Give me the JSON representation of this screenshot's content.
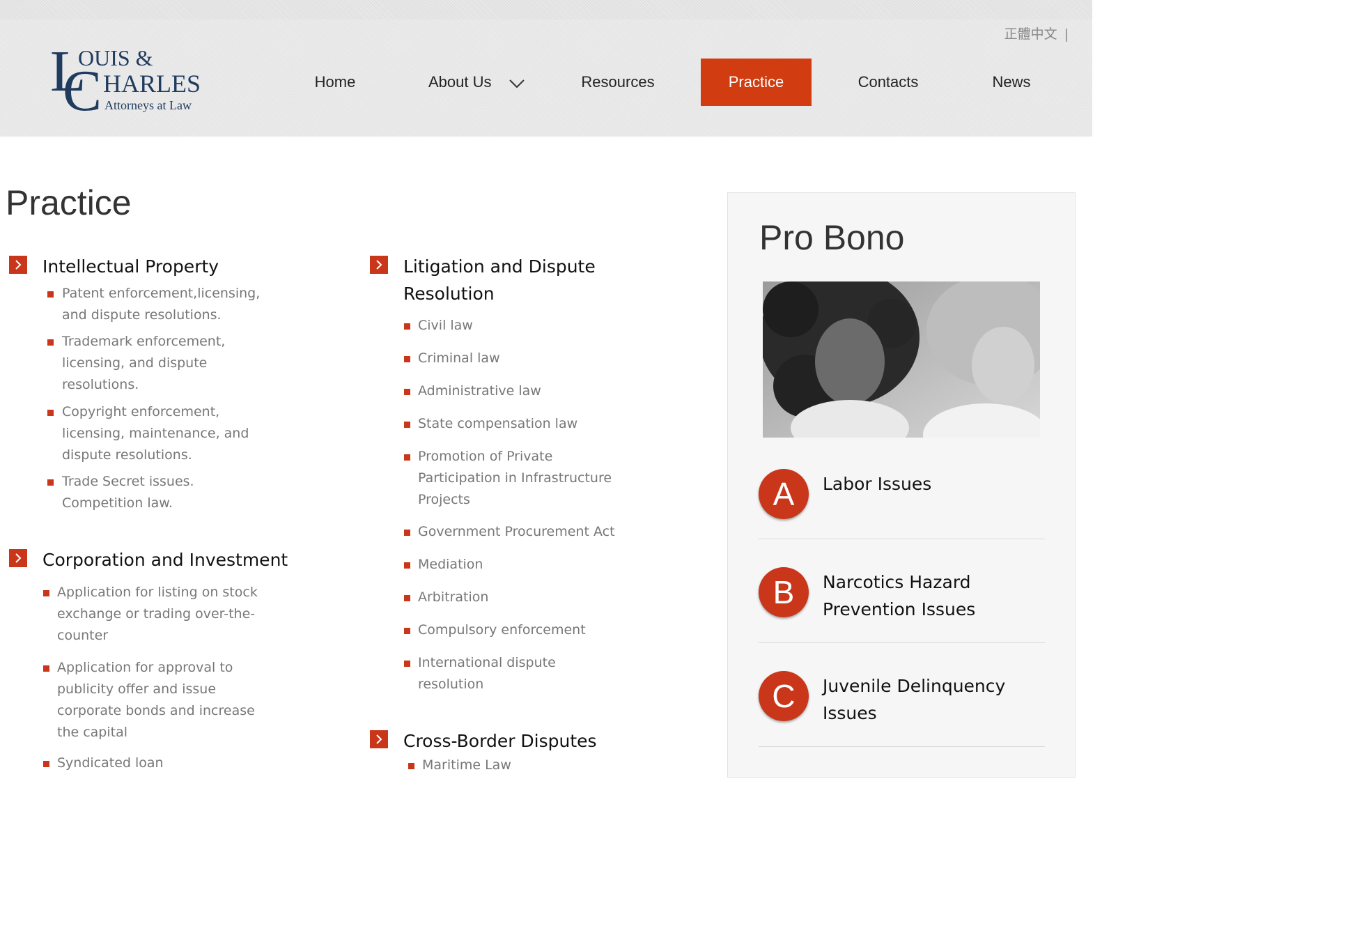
{
  "header": {
    "language_link": "正體中文",
    "language_separator": "|",
    "logo": {
      "letters_1": "OUIS &",
      "letters_2": "HARLES",
      "tagline": "Attorneys at Law"
    },
    "nav": {
      "home": "Home",
      "about": "About Us",
      "resources": "Resources",
      "practice": "Practice",
      "contacts": "Contacts",
      "news": "News"
    },
    "accent_color": "#d13c10"
  },
  "main": {
    "title": "Practice",
    "ip": {
      "title": "Intellectual Property",
      "items": [
        [
          "Patent enforcement,licensing,",
          "and dispute resolutions."
        ],
        [
          "Trademark enforcement,",
          "licensing, and dispute",
          "resolutions."
        ],
        [
          "Copyright enforcement,",
          "licensing, maintenance, and",
          "dispute resolutions."
        ],
        [
          "Trade Secret issues.",
          "Competition law."
        ]
      ]
    },
    "corp": {
      "title": "Corporation and Investment",
      "items": [
        [
          "Application for listing on stock",
          "exchange or trading over-the-",
          "counter"
        ],
        [
          "Application for approval to",
          "publicity offer and issue",
          "corporate bonds and increase",
          "the capital"
        ],
        [
          "Syndicated loan"
        ]
      ]
    },
    "litigation": {
      "title_1": "Litigation and Dispute",
      "title_2": "Resolution",
      "items": [
        [
          "Civil law"
        ],
        [
          "Criminal law"
        ],
        [
          "Administrative law"
        ],
        [
          "State compensation law"
        ],
        [
          "Promotion of Private",
          "Participation in Infrastructure",
          "Projects"
        ],
        [
          "Government Procurement Act"
        ],
        [
          "Mediation"
        ],
        [
          "Arbitration"
        ],
        [
          "Compulsory enforcement"
        ],
        [
          "International dispute",
          "resolution"
        ]
      ]
    },
    "crossborder": {
      "title": "Cross-Border Disputes",
      "items": [
        [
          "Maritime Law"
        ]
      ]
    }
  },
  "sidebar": {
    "title": "Pro Bono",
    "photo": "pro-bono-photo",
    "issues": [
      {
        "letter": "A",
        "lines": [
          "Labor Issues"
        ]
      },
      {
        "letter": "B",
        "lines": [
          "Narcotics Hazard",
          "Prevention Issues"
        ]
      },
      {
        "letter": "C",
        "lines": [
          "Juvenile Delinquency",
          "Issues"
        ]
      }
    ]
  }
}
